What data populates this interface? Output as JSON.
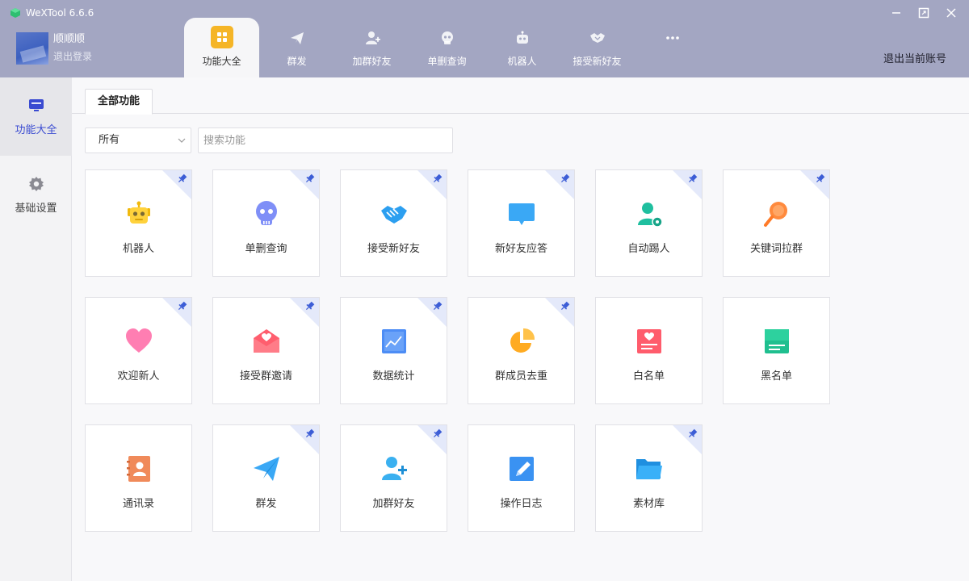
{
  "app": {
    "title": "WeXTool 6.6.6"
  },
  "user": {
    "name": "顺顺顺",
    "logout_link": "退出登录"
  },
  "top_tabs": [
    {
      "label": "功能大全",
      "icon": "grid-icon",
      "active": true
    },
    {
      "label": "群发",
      "icon": "paper-plane-icon",
      "active": false
    },
    {
      "label": "加群好友",
      "icon": "add-user-icon",
      "active": false
    },
    {
      "label": "单删查询",
      "icon": "skull-icon",
      "active": false
    },
    {
      "label": "机器人",
      "icon": "robot-icon",
      "active": false
    },
    {
      "label": "接受新好友",
      "icon": "handshake-icon",
      "active": false
    },
    {
      "label": "",
      "icon": "more-icon",
      "active": false
    }
  ],
  "header": {
    "logout_account": "退出当前账号"
  },
  "sidebar": {
    "items": [
      {
        "label": "功能大全",
        "icon": "monitor-icon",
        "active": true
      },
      {
        "label": "基础设置",
        "icon": "gear-icon",
        "active": false
      }
    ]
  },
  "main": {
    "tab_label": "全部功能",
    "filter": {
      "value": "所有"
    },
    "search": {
      "placeholder": "搜索功能"
    },
    "cards": [
      {
        "label": "机器人",
        "icon": "robot-icon",
        "pinned": true
      },
      {
        "label": "单删查询",
        "icon": "skull-icon",
        "pinned": true
      },
      {
        "label": "接受新好友",
        "icon": "handshake-icon",
        "pinned": true
      },
      {
        "label": "新好友应答",
        "icon": "chat-bubble-icon",
        "pinned": true
      },
      {
        "label": "自动踢人",
        "icon": "kick-user-icon",
        "pinned": true
      },
      {
        "label": "关键词拉群",
        "icon": "magnifier-icon",
        "pinned": true
      },
      {
        "label": "欢迎新人",
        "icon": "heart-icon",
        "pinned": true
      },
      {
        "label": "接受群邀请",
        "icon": "envelope-heart-icon",
        "pinned": true
      },
      {
        "label": "数据统计",
        "icon": "line-chart-icon",
        "pinned": true
      },
      {
        "label": "群成员去重",
        "icon": "pie-chart-icon",
        "pinned": true
      },
      {
        "label": "白名单",
        "icon": "whitelist-icon",
        "pinned": false
      },
      {
        "label": "黑名单",
        "icon": "blacklist-icon",
        "pinned": false
      },
      {
        "label": "通讯录",
        "icon": "contacts-book-icon",
        "pinned": false
      },
      {
        "label": "群发",
        "icon": "paper-plane-icon",
        "pinned": true
      },
      {
        "label": "加群好友",
        "icon": "add-user-icon",
        "pinned": true
      },
      {
        "label": "操作日志",
        "icon": "edit-log-icon",
        "pinned": false
      },
      {
        "label": "素材库",
        "icon": "folder-icon",
        "pinned": true
      }
    ]
  },
  "colors": {
    "header_bg": "#a3a6c2",
    "accent": "#3a4bd1",
    "tab_icon_bg": "#f5b527",
    "pin": "#3c5dd6"
  }
}
